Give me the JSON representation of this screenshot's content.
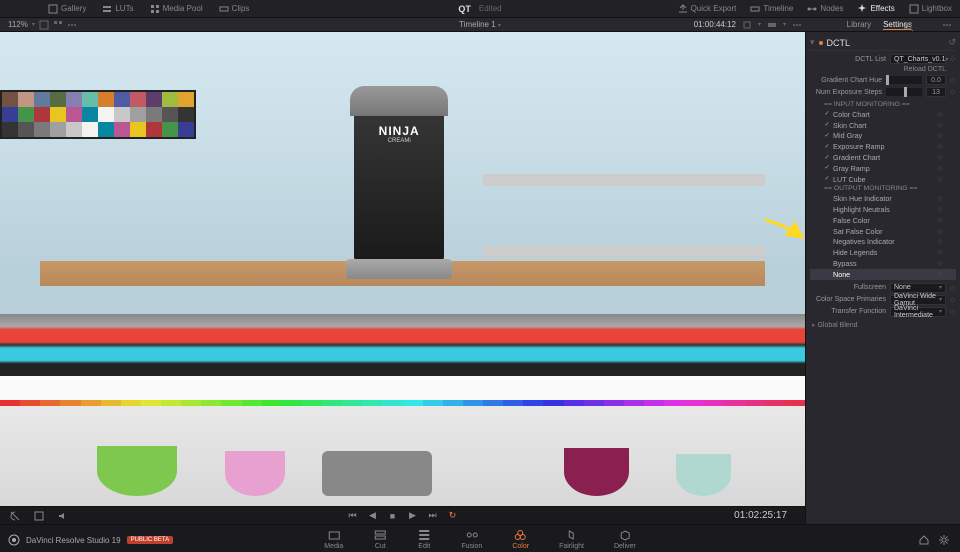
{
  "topbar": {
    "gallery": "Gallery",
    "luts": "LUTs",
    "mediapool": "Media Pool",
    "clips": "Clips",
    "project": "QT",
    "edited": "Edited",
    "quickexport": "Quick Export",
    "timeline": "Timeline",
    "nodes": "Nodes",
    "effects": "Effects",
    "lightbox": "Lightbox"
  },
  "secbar": {
    "zoom": "112%",
    "timeline_name": "Timeline 1",
    "timecode": "01:00:44:12",
    "tab_library": "Library",
    "tab_settings": "Settings"
  },
  "viewer": {
    "brand": "NINJA",
    "brand_sub": "CREAMi"
  },
  "transport": {
    "timecode": "01:02:25:17"
  },
  "panel": {
    "title": "DCTL",
    "dctl_list_label": "DCTL List",
    "dctl_list_value": "QT_Charts_v0.1",
    "reload": "Reload DCTL",
    "chart_hue_label": "Gradient Chart Hue",
    "chart_hue_value": "0.0",
    "exposure_label": "Num Exposure Steps",
    "exposure_value": "13",
    "sec_input": "== INPUT MONITORING ==",
    "items_in": [
      {
        "checked": true,
        "label": "Color Chart"
      },
      {
        "checked": true,
        "label": "Skin Chart"
      },
      {
        "checked": true,
        "label": "Mid Gray"
      },
      {
        "checked": true,
        "label": "Exposure Ramp"
      },
      {
        "checked": true,
        "label": "Gradient Chart"
      },
      {
        "checked": true,
        "label": "Gray Ramp"
      },
      {
        "checked": true,
        "label": "LUT Cube"
      }
    ],
    "sec_output": "== OUTPUT MONITORING ==",
    "items_out": [
      {
        "checked": false,
        "label": "Skin Hue Indicator"
      },
      {
        "checked": false,
        "label": "Highlight Neutrals"
      },
      {
        "checked": false,
        "label": "False Color"
      },
      {
        "checked": false,
        "label": "Sat False Color"
      },
      {
        "checked": false,
        "label": "Negatives Indicator"
      },
      {
        "checked": false,
        "label": "Hide Legends"
      },
      {
        "checked": false,
        "label": "Bypass"
      },
      {
        "checked": false,
        "label": "None",
        "selected": true
      }
    ],
    "fullscreen_label": "Fullscreen",
    "csp_label": "Color Space Primaries",
    "csp_value": "DaVinci Wide Gamut",
    "tf_label": "Transfer Function",
    "tf_value": "DaVinci Intermediate",
    "global_blend": "Global Blend"
  },
  "pages": {
    "media": "Media",
    "cut": "Cut",
    "edit": "Edit",
    "fusion": "Fusion",
    "color": "Color",
    "fairlight": "Fairlight",
    "deliver": "Deliver"
  },
  "app": {
    "name": "DaVinci Resolve Studio 19",
    "beta": "PUBLIC BETA"
  },
  "colorchecker": [
    "#735244",
    "#c29682",
    "#627a9d",
    "#576c43",
    "#8580b1",
    "#67bdaa",
    "#d67e2c",
    "#505ba6",
    "#c15a63",
    "#5e3c6c",
    "#9dbc40",
    "#e0a32e",
    "#383d96",
    "#469449",
    "#af363c",
    "#e7c71f",
    "#bb5695",
    "#0885a1",
    "#f3f3f2",
    "#c8c8c8",
    "#a0a0a0",
    "#7a7a7a",
    "#555555",
    "#343434",
    "#343434",
    "#555555",
    "#7a7a7a",
    "#a0a0a0",
    "#c8c8c8",
    "#f3f3f2",
    "#0885a1",
    "#bb5695",
    "#e7c71f",
    "#af363c",
    "#469449",
    "#383d96"
  ]
}
